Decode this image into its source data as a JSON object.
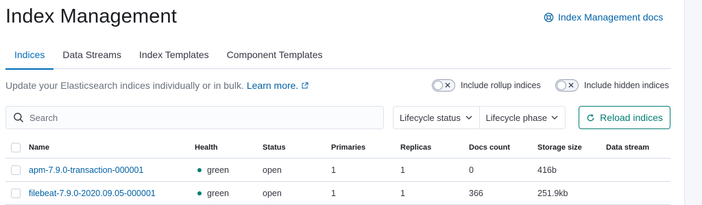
{
  "page": {
    "title": "Index Management",
    "docs_link": "Index Management docs"
  },
  "tabs": [
    {
      "label": "Indices",
      "selected": true
    },
    {
      "label": "Data Streams",
      "selected": false
    },
    {
      "label": "Index Templates",
      "selected": false
    },
    {
      "label": "Component Templates",
      "selected": false
    }
  ],
  "description": {
    "text": "Update your Elasticsearch indices individually or in bulk.",
    "learn_more": "Learn more."
  },
  "toggles": {
    "rollup": {
      "label": "Include rollup indices",
      "on": false
    },
    "hidden": {
      "label": "Include hidden indices",
      "on": false
    }
  },
  "search": {
    "placeholder": "Search",
    "value": ""
  },
  "filters": {
    "lifecycle_status": "Lifecycle status",
    "lifecycle_phase": "Lifecycle phase"
  },
  "reload_button": "Reload indices",
  "table": {
    "columns": [
      "Name",
      "Health",
      "Status",
      "Primaries",
      "Replicas",
      "Docs count",
      "Storage size",
      "Data stream"
    ],
    "rows": [
      {
        "name": "apm-7.9.0-transaction-000001",
        "health": "green",
        "status": "open",
        "primaries": "1",
        "replicas": "1",
        "docs_count": "0",
        "storage_size": "416b",
        "data_stream": ""
      },
      {
        "name": "filebeat-7.9.0-2020.09.05-000001",
        "health": "green",
        "status": "open",
        "primaries": "1",
        "replicas": "1",
        "docs_count": "366",
        "storage_size": "251.9kb",
        "data_stream": ""
      }
    ]
  },
  "colors": {
    "link": "#0061a6",
    "tab_selected": "#006bb8",
    "health_green": "#017d73",
    "reload_accent": "#017d73"
  },
  "icons": {
    "docs": "help-circle-icon",
    "external": "external-link-icon",
    "search": "search-icon",
    "chevron": "chevron-down-icon",
    "reload": "refresh-icon"
  }
}
